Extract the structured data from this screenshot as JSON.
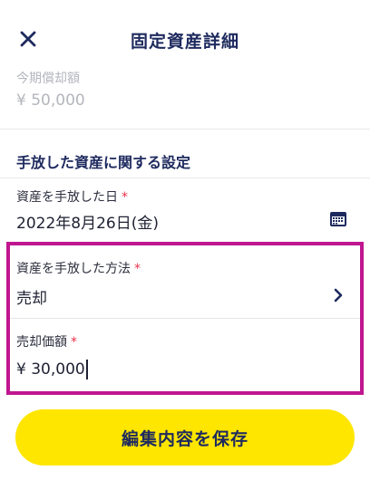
{
  "header": {
    "title": "固定資産詳細",
    "close_icon": "close-icon"
  },
  "current_depreciation": {
    "label": "今期償却額",
    "value": "¥ 50,000"
  },
  "section": {
    "title": "手放した資産に関する設定"
  },
  "disposal_date": {
    "label": "資産を手放した日",
    "required_mark": "*",
    "value": "2022年8月26日(金)",
    "icon": "calendar-icon"
  },
  "disposal_method": {
    "label": "資産を手放した方法",
    "required_mark": "*",
    "value": "売却",
    "icon": "chevron-right-icon"
  },
  "sale_price": {
    "label": "売却価額",
    "required_mark": "*",
    "value": "¥ 30,000"
  },
  "save_button": {
    "label": "編集内容を保存"
  },
  "colors": {
    "accent_navy": "#1e2a5e",
    "required_red": "#e8334a",
    "highlight_magenta": "#c0168f",
    "button_yellow": "#ffe600"
  }
}
